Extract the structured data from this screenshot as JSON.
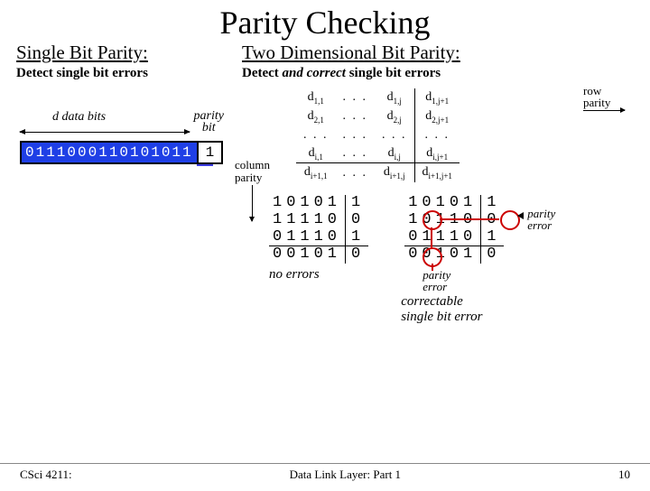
{
  "title": "Parity Checking",
  "left": {
    "heading": "Single Bit Parity:",
    "desc": "Detect single bit errors",
    "dlabel": "d data bits",
    "plabel_l1": "parity",
    "plabel_l2": "bit",
    "bits": "0111000110101011",
    "parity": "1"
  },
  "right": {
    "heading": "Two Dimensional Bit Parity:",
    "desc_pre": "Detect ",
    "desc_em": "and correct",
    "desc_post": " single bit errors",
    "rowp_l1": "row",
    "rowp_l2": "parity",
    "colp_l1": "column",
    "colp_l2": "parity",
    "mat": {
      "r1": [
        "d",
        "1,1",
        ". . .",
        "d",
        "1,j",
        "d",
        "1,j+1"
      ],
      "r2": [
        "d",
        "2,1",
        ". . .",
        "d",
        "2,j",
        "d",
        "2,j+1"
      ],
      "r3": [
        ". . .",
        ". . .",
        ". . .",
        ". . ."
      ],
      "r4": [
        "d",
        "i,1",
        ". . .",
        "d",
        "i,j",
        "d",
        "i,j+1"
      ],
      "r5": [
        "d",
        "i+1,1",
        ". . .",
        "d",
        "i+1,j",
        "d",
        "i+1,j+1"
      ]
    },
    "ex1": {
      "rows": [
        "10101",
        "11110",
        "01110"
      ],
      "rowp": [
        "1",
        "0",
        "1"
      ],
      "colp": "00101",
      "corner": "0",
      "label": "no errors"
    },
    "ex2": {
      "rows": [
        "10101",
        "10110",
        "01110"
      ],
      "rowp": [
        "1",
        "0",
        "1"
      ],
      "colp": "00101",
      "corner": "0",
      "perr_right": "parity error",
      "perr_bottom": "parity error",
      "corr_l1": "correctable",
      "corr_l2": "single bit error"
    }
  },
  "footer": {
    "left": "CSci 4211:",
    "center": "Data Link Layer: Part 1",
    "right": "10"
  }
}
